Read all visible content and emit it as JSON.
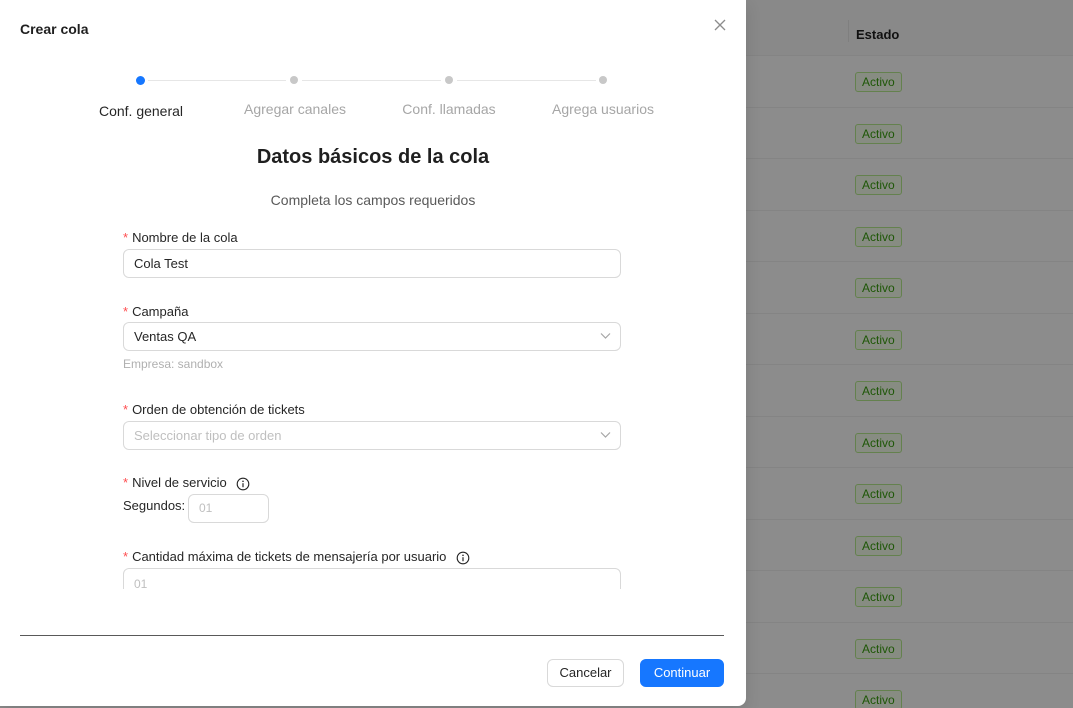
{
  "background": {
    "column_header": "Estado",
    "row_status": "Activo",
    "row_count": 13
  },
  "modal": {
    "title": "Crear cola",
    "close_icon": "close-icon"
  },
  "steps": [
    {
      "label": "Conf. general",
      "active": true
    },
    {
      "label": "Agregar canales",
      "active": false
    },
    {
      "label": "Conf. llamadas",
      "active": false
    },
    {
      "label": "Agrega usuarios",
      "active": false
    }
  ],
  "form": {
    "title": "Datos básicos de la cola",
    "subtitle": "Completa los campos requeridos",
    "required_mark": "*",
    "queue_name": {
      "label": "Nombre de la cola",
      "value": "Cola Test"
    },
    "campaign": {
      "label": "Campaña",
      "value": "Ventas QA",
      "hint": "Empresa: sandbox"
    },
    "ticket_order": {
      "label": "Orden de obtención de tickets",
      "placeholder": "Seleccionar tipo de orden"
    },
    "service_level": {
      "label": "Nivel de servicio",
      "seconds_label": "Segundos:",
      "placeholder": "01"
    },
    "max_tickets": {
      "label": "Cantidad máxima de tickets de mensajería por usuario",
      "placeholder": "01"
    }
  },
  "footer": {
    "cancel_label": "Cancelar",
    "continue_label": "Continuar"
  },
  "colors": {
    "primary": "#1677ff",
    "required": "#ff4d4f",
    "tag_green": "#389e0d"
  }
}
